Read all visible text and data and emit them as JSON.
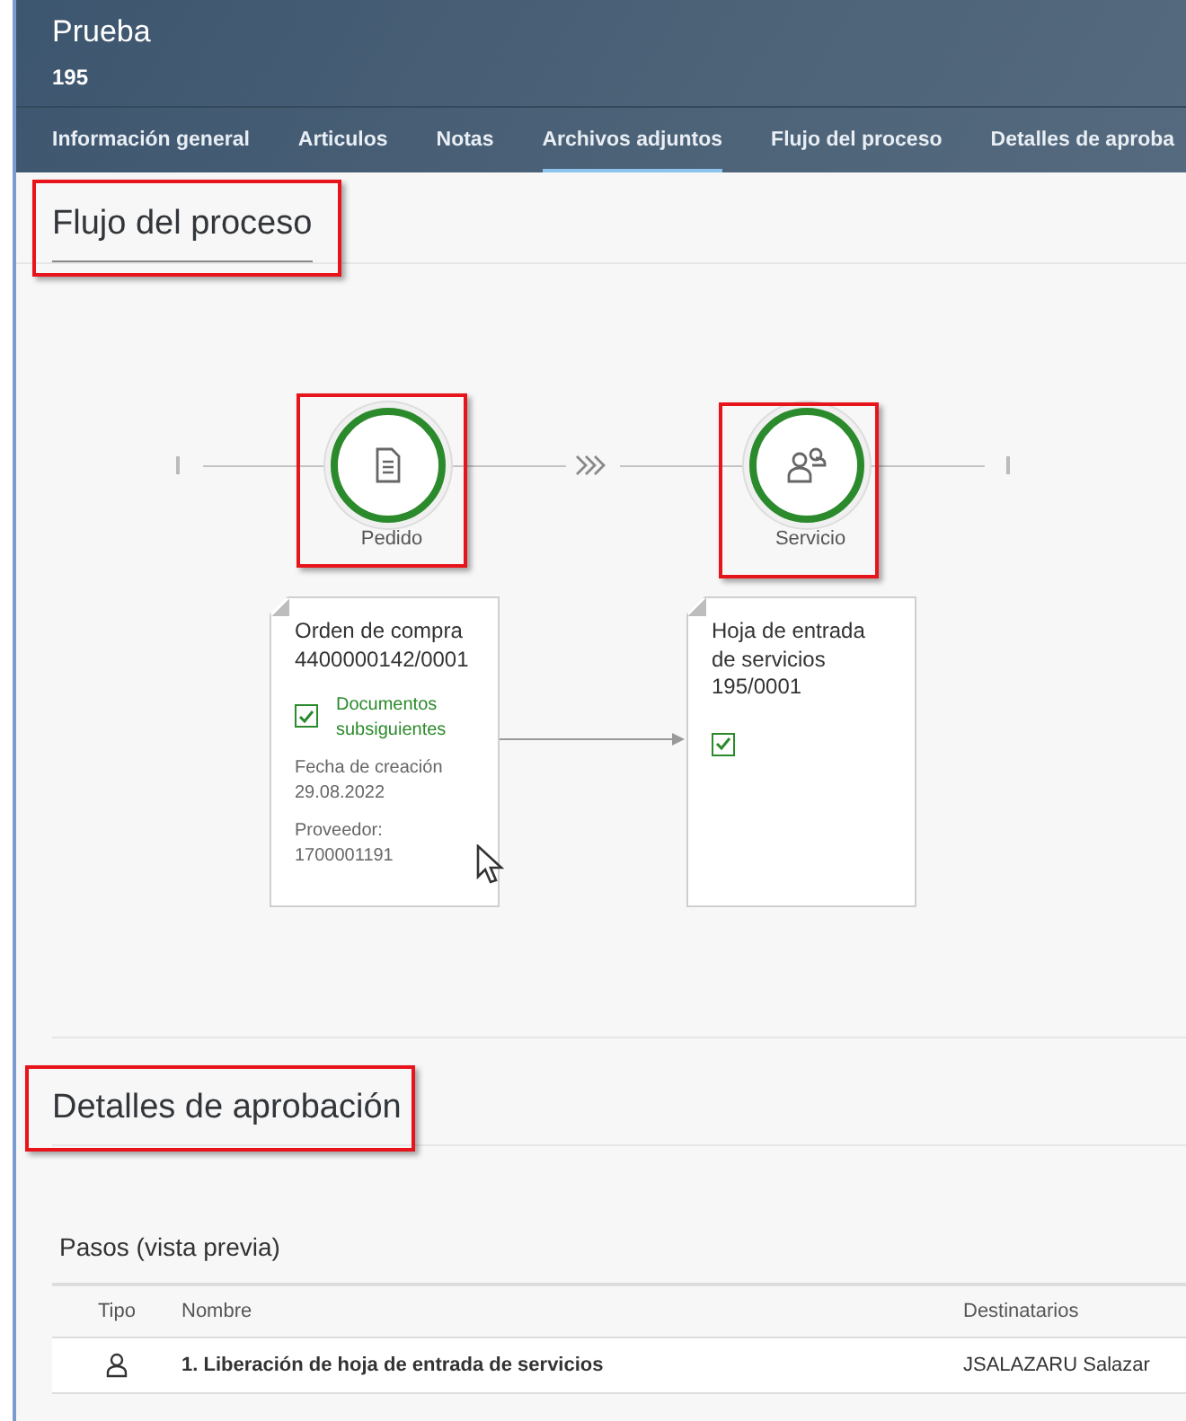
{
  "header": {
    "title": "Prueba",
    "subtitle": "195"
  },
  "tabs": [
    {
      "label": "Información general",
      "selected": false
    },
    {
      "label": "Articulos",
      "selected": false
    },
    {
      "label": "Notas",
      "selected": false
    },
    {
      "label": "Archivos adjuntos",
      "selected": true
    },
    {
      "label": "Flujo del proceso",
      "selected": false
    },
    {
      "label": "Detalles de aproba",
      "selected": false
    }
  ],
  "process_flow": {
    "heading": "Flujo del proceso",
    "highlighted": true,
    "lanes": [
      {
        "label": "Pedido",
        "kind": "document",
        "highlighted": true
      },
      {
        "label": "Servicio",
        "kind": "people",
        "highlighted": true
      }
    ],
    "nodes": [
      {
        "title": "Orden de compra 4400000142/0001",
        "checked": true,
        "status": "Documentos subsiguientes",
        "fields": [
          {
            "label": "Fecha de creación",
            "value": "29.08.2022"
          },
          {
            "label": "Proveedor:",
            "value": "1700001191"
          }
        ]
      },
      {
        "title": "Hoja de entrada de servicios 195/0001",
        "checked": true
      }
    ]
  },
  "approval": {
    "heading": "Detalles de aprobación",
    "highlighted": true,
    "table_title": "Pasos (vista previa)",
    "columns": [
      "Tipo",
      "Nombre",
      "Destinatarios"
    ],
    "rows": [
      {
        "kind": "person",
        "name": "1. Liberación de hoja de entrada de servicios",
        "recipients": "JSALAZARU Salazar"
      }
    ]
  }
}
